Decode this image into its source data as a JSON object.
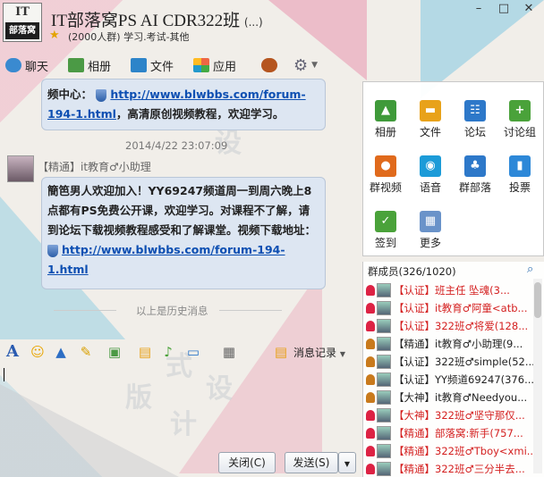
{
  "window": {
    "logo_top": "IT",
    "logo_bottom": "部落窝",
    "title": "IT部落窝PS AI CDR322班",
    "title_suffix": "(...)",
    "subtitle": "(2000人群) 学习.考试-其他",
    "controls": {
      "minimize": "–",
      "maximize": "□",
      "close": "✕"
    }
  },
  "tabs": [
    {
      "label": "聊天",
      "icon": "chat-icon"
    },
    {
      "label": "相册",
      "icon": "album-icon"
    },
    {
      "label": "文件",
      "icon": "folder-icon"
    },
    {
      "label": "应用",
      "icon": "apps-icon"
    }
  ],
  "messages": {
    "first": {
      "prefix": "频中心：",
      "link": "http://www.blwbbs.com/forum-194-1.html",
      "suffix": "，高清原创视频教程，欢迎学习。"
    },
    "timestamp": "2014/4/22 23:07:09",
    "second": {
      "sender": "【精通】it教育♂小助理",
      "text": "簡笆男人欢迎加入！YY69247频道周一到周六晚上8点都有PS免费公开课，欢迎学习。对课程不了解，请到论坛下载视频教程感受和了解课堂。视频下载地址：",
      "link": "http://www.blwbbs.com/forum-194-1.html"
    },
    "history_label": "以上是历史消息"
  },
  "apps": [
    {
      "label": "相册",
      "color": "#3f9a3a",
      "glyph": "▲"
    },
    {
      "label": "文件",
      "color": "#e8a21a",
      "glyph": "▬"
    },
    {
      "label": "论坛",
      "color": "#2d78c9",
      "glyph": "☷"
    },
    {
      "label": "讨论组",
      "color": "#4aa23a",
      "glyph": "+"
    },
    {
      "label": "群视频",
      "color": "#e06a1c",
      "glyph": "●"
    },
    {
      "label": "语音",
      "color": "#1c9bd8",
      "glyph": "◉"
    },
    {
      "label": "群部落",
      "color": "#2d78c9",
      "glyph": "♣"
    },
    {
      "label": "投票",
      "color": "#2d88d8",
      "glyph": "▮"
    },
    {
      "label": "签到",
      "color": "#4aa23a",
      "glyph": "✓"
    },
    {
      "label": "更多",
      "color": "#6a93c9",
      "glyph": "▦"
    }
  ],
  "members": {
    "title": "群成员(326/1020)",
    "list": [
      {
        "text": "【认证】班主任 坠魂(3...",
        "color": "#d42020"
      },
      {
        "text": "【认证】it教育♂阿童<atb...",
        "color": "#d42020"
      },
      {
        "text": "【认证】322班♂将爱(128...",
        "color": "#d42020"
      },
      {
        "text": "【精通】it教育♂小助理(9...",
        "color": "#222222"
      },
      {
        "text": "【认证】322班♂simple(52...",
        "color": "#222222"
      },
      {
        "text": "【认证】YY频道69247(376...",
        "color": "#222222"
      },
      {
        "text": "【大神】it教育♂Needyou...",
        "color": "#222222"
      },
      {
        "text": "【大神】322班♂坚守那仅...",
        "color": "#d42020"
      },
      {
        "text": "【精通】部落窝:新手(757...",
        "color": "#d42020"
      },
      {
        "text": "【精通】322班♂Tboy<xmi...",
        "color": "#d42020"
      },
      {
        "text": "【精通】322班♂三分半去...",
        "color": "#d42020"
      }
    ]
  },
  "toolbar": {
    "history_label": "消息记录"
  },
  "buttons": {
    "close": "关闭(C)",
    "send": "发送(S)"
  },
  "watermark": [
    "设",
    "计",
    "式",
    "版",
    "设",
    "计"
  ]
}
